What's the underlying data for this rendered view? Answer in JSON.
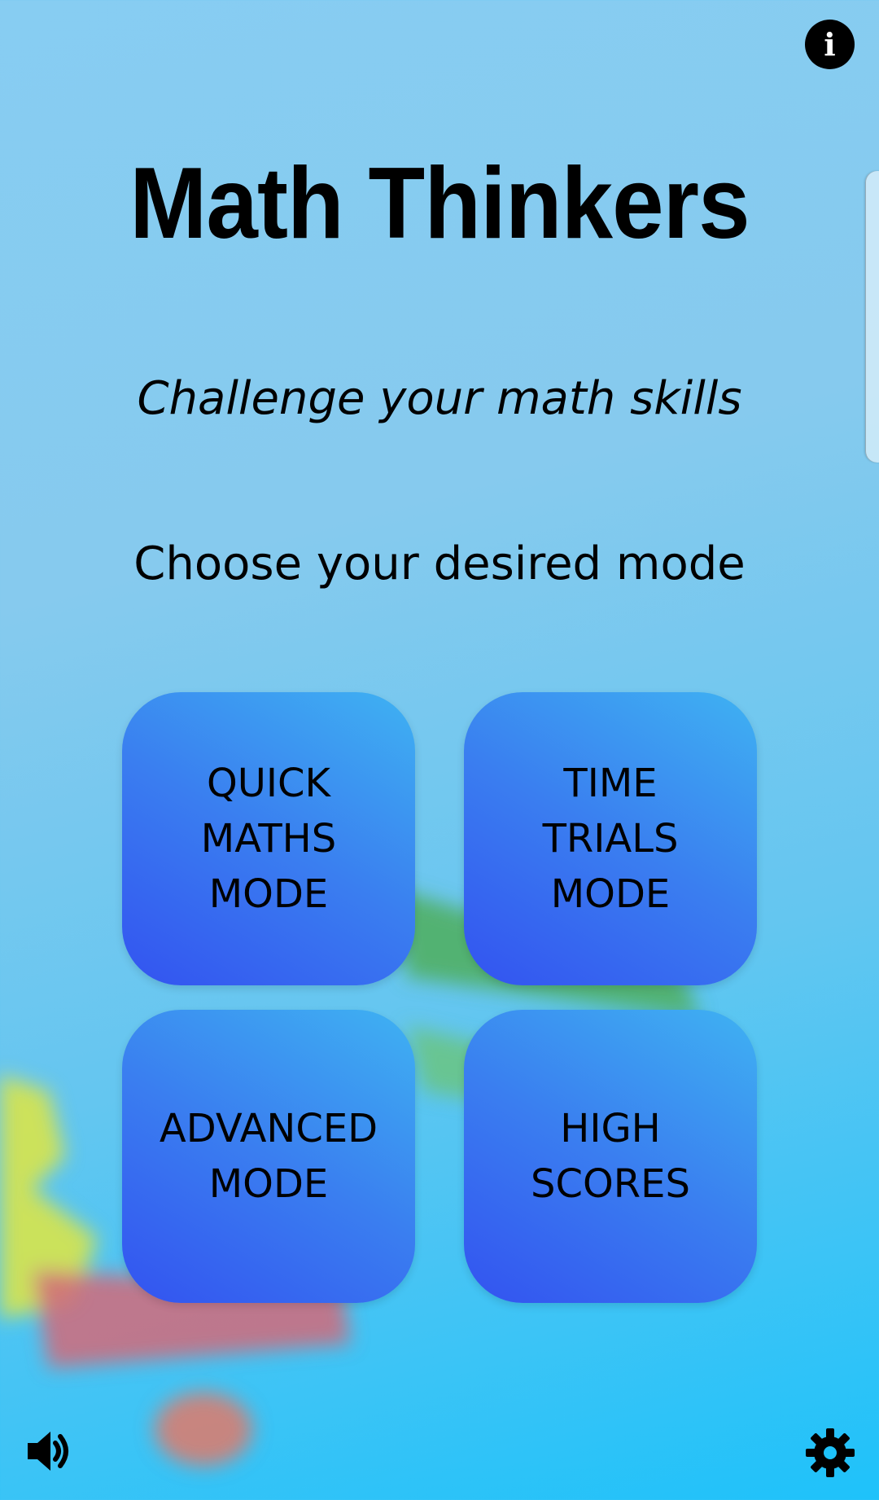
{
  "app": {
    "title": "Math Thinkers",
    "subtitle": "Challenge your math skills",
    "prompt": "Choose your desired mode"
  },
  "modes": [
    {
      "label": "QUICK\nMATHS\nMODE"
    },
    {
      "label": "TIME\nTRIALS\nMODE"
    },
    {
      "label": "ADVANCED\nMODE"
    },
    {
      "label": "HIGH\nSCORES"
    }
  ],
  "icons": {
    "info": "info-icon",
    "sound": "speaker-icon",
    "settings": "gear-icon"
  },
  "info_glyph": "i",
  "colors": {
    "button_gradient_start": "#3353f0",
    "button_gradient_end": "#3fb2f2",
    "background_top": "#87cdf2",
    "background_bottom": "#1ec2fa"
  }
}
